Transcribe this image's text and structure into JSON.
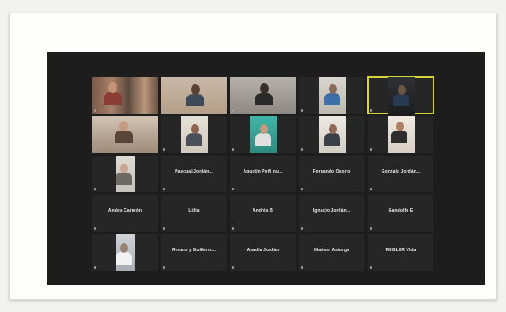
{
  "colors": {
    "meeting_bg": "#1d1d1d",
    "tile_bg": "#262626",
    "active_border": "#d7d23a"
  },
  "tiles": [
    {
      "video": "full",
      "scene": "group",
      "name": "",
      "sub": ""
    },
    {
      "video": "full",
      "scene": "man-wall",
      "name": "",
      "sub": ""
    },
    {
      "video": "full",
      "scene": "man-dark",
      "name": "",
      "sub": ""
    },
    {
      "video": "mid",
      "scene": "blue-shirt",
      "name": "",
      "sub": ""
    },
    {
      "video": "mid",
      "scene": "dark-room",
      "name": "",
      "sub": "",
      "active": true
    },
    {
      "video": "full",
      "scene": "hand",
      "name": "",
      "sub": ""
    },
    {
      "video": "mid",
      "scene": "light-room",
      "name": "",
      "sub": ""
    },
    {
      "video": "mid",
      "scene": "teal",
      "name": "",
      "sub": ""
    },
    {
      "video": "mid",
      "scene": "light-room2",
      "name": "",
      "sub": ""
    },
    {
      "video": "mid",
      "scene": "face-close",
      "name": "",
      "sub": ""
    },
    {
      "video": "narrow",
      "scene": "face-pale",
      "name": "",
      "sub": ""
    },
    {
      "video": "none",
      "name": "Pascual Jordán...",
      "sub": ""
    },
    {
      "video": "none",
      "name": "Agustín Peñi nu...",
      "sub": ""
    },
    {
      "video": "none",
      "name": "Fernando Osorio",
      "sub": ""
    },
    {
      "video": "none",
      "name": "Gonzalo Jordán...",
      "sub": ""
    },
    {
      "video": "none",
      "name": "Andes Carreón",
      "sub": ""
    },
    {
      "video": "none",
      "name": "Lidia",
      "sub": ""
    },
    {
      "video": "none",
      "name": "Andrés B",
      "sub": ""
    },
    {
      "video": "none",
      "name": "Ignacio Jordán...",
      "sub": ""
    },
    {
      "video": "none",
      "name": "Gandolfo E",
      "sub": ""
    },
    {
      "video": "narrow",
      "scene": "grey-person",
      "name": "",
      "sub": ""
    },
    {
      "video": "none",
      "name": "Renato y Guillerm...",
      "sub": ""
    },
    {
      "video": "none",
      "name": "Amalia Jordán",
      "sub": ""
    },
    {
      "video": "none",
      "name": "Marisol Astorga",
      "sub": ""
    },
    {
      "video": "none",
      "name": "REGLER Vida",
      "sub": ""
    }
  ]
}
